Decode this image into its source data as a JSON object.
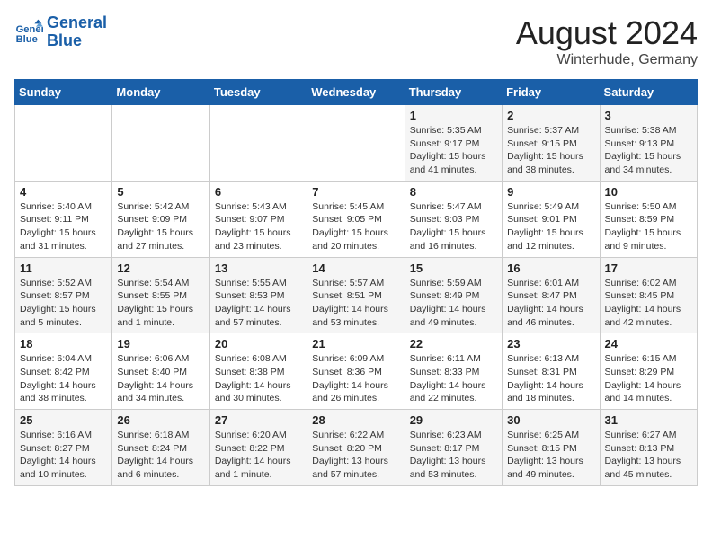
{
  "header": {
    "logo_line1": "General",
    "logo_line2": "Blue",
    "title": "August 2024",
    "subtitle": "Winterhude, Germany"
  },
  "days_of_week": [
    "Sunday",
    "Monday",
    "Tuesday",
    "Wednesday",
    "Thursday",
    "Friday",
    "Saturday"
  ],
  "weeks": [
    [
      {
        "day": "",
        "info": ""
      },
      {
        "day": "",
        "info": ""
      },
      {
        "day": "",
        "info": ""
      },
      {
        "day": "",
        "info": ""
      },
      {
        "day": "1",
        "info": "Sunrise: 5:35 AM\nSunset: 9:17 PM\nDaylight: 15 hours\nand 41 minutes."
      },
      {
        "day": "2",
        "info": "Sunrise: 5:37 AM\nSunset: 9:15 PM\nDaylight: 15 hours\nand 38 minutes."
      },
      {
        "day": "3",
        "info": "Sunrise: 5:38 AM\nSunset: 9:13 PM\nDaylight: 15 hours\nand 34 minutes."
      }
    ],
    [
      {
        "day": "4",
        "info": "Sunrise: 5:40 AM\nSunset: 9:11 PM\nDaylight: 15 hours\nand 31 minutes."
      },
      {
        "day": "5",
        "info": "Sunrise: 5:42 AM\nSunset: 9:09 PM\nDaylight: 15 hours\nand 27 minutes."
      },
      {
        "day": "6",
        "info": "Sunrise: 5:43 AM\nSunset: 9:07 PM\nDaylight: 15 hours\nand 23 minutes."
      },
      {
        "day": "7",
        "info": "Sunrise: 5:45 AM\nSunset: 9:05 PM\nDaylight: 15 hours\nand 20 minutes."
      },
      {
        "day": "8",
        "info": "Sunrise: 5:47 AM\nSunset: 9:03 PM\nDaylight: 15 hours\nand 16 minutes."
      },
      {
        "day": "9",
        "info": "Sunrise: 5:49 AM\nSunset: 9:01 PM\nDaylight: 15 hours\nand 12 minutes."
      },
      {
        "day": "10",
        "info": "Sunrise: 5:50 AM\nSunset: 8:59 PM\nDaylight: 15 hours\nand 9 minutes."
      }
    ],
    [
      {
        "day": "11",
        "info": "Sunrise: 5:52 AM\nSunset: 8:57 PM\nDaylight: 15 hours\nand 5 minutes."
      },
      {
        "day": "12",
        "info": "Sunrise: 5:54 AM\nSunset: 8:55 PM\nDaylight: 15 hours\nand 1 minute."
      },
      {
        "day": "13",
        "info": "Sunrise: 5:55 AM\nSunset: 8:53 PM\nDaylight: 14 hours\nand 57 minutes."
      },
      {
        "day": "14",
        "info": "Sunrise: 5:57 AM\nSunset: 8:51 PM\nDaylight: 14 hours\nand 53 minutes."
      },
      {
        "day": "15",
        "info": "Sunrise: 5:59 AM\nSunset: 8:49 PM\nDaylight: 14 hours\nand 49 minutes."
      },
      {
        "day": "16",
        "info": "Sunrise: 6:01 AM\nSunset: 8:47 PM\nDaylight: 14 hours\nand 46 minutes."
      },
      {
        "day": "17",
        "info": "Sunrise: 6:02 AM\nSunset: 8:45 PM\nDaylight: 14 hours\nand 42 minutes."
      }
    ],
    [
      {
        "day": "18",
        "info": "Sunrise: 6:04 AM\nSunset: 8:42 PM\nDaylight: 14 hours\nand 38 minutes."
      },
      {
        "day": "19",
        "info": "Sunrise: 6:06 AM\nSunset: 8:40 PM\nDaylight: 14 hours\nand 34 minutes."
      },
      {
        "day": "20",
        "info": "Sunrise: 6:08 AM\nSunset: 8:38 PM\nDaylight: 14 hours\nand 30 minutes."
      },
      {
        "day": "21",
        "info": "Sunrise: 6:09 AM\nSunset: 8:36 PM\nDaylight: 14 hours\nand 26 minutes."
      },
      {
        "day": "22",
        "info": "Sunrise: 6:11 AM\nSunset: 8:33 PM\nDaylight: 14 hours\nand 22 minutes."
      },
      {
        "day": "23",
        "info": "Sunrise: 6:13 AM\nSunset: 8:31 PM\nDaylight: 14 hours\nand 18 minutes."
      },
      {
        "day": "24",
        "info": "Sunrise: 6:15 AM\nSunset: 8:29 PM\nDaylight: 14 hours\nand 14 minutes."
      }
    ],
    [
      {
        "day": "25",
        "info": "Sunrise: 6:16 AM\nSunset: 8:27 PM\nDaylight: 14 hours\nand 10 minutes."
      },
      {
        "day": "26",
        "info": "Sunrise: 6:18 AM\nSunset: 8:24 PM\nDaylight: 14 hours\nand 6 minutes."
      },
      {
        "day": "27",
        "info": "Sunrise: 6:20 AM\nSunset: 8:22 PM\nDaylight: 14 hours\nand 1 minute."
      },
      {
        "day": "28",
        "info": "Sunrise: 6:22 AM\nSunset: 8:20 PM\nDaylight: 13 hours\nand 57 minutes."
      },
      {
        "day": "29",
        "info": "Sunrise: 6:23 AM\nSunset: 8:17 PM\nDaylight: 13 hours\nand 53 minutes."
      },
      {
        "day": "30",
        "info": "Sunrise: 6:25 AM\nSunset: 8:15 PM\nDaylight: 13 hours\nand 49 minutes."
      },
      {
        "day": "31",
        "info": "Sunrise: 6:27 AM\nSunset: 8:13 PM\nDaylight: 13 hours\nand 45 minutes."
      }
    ]
  ]
}
